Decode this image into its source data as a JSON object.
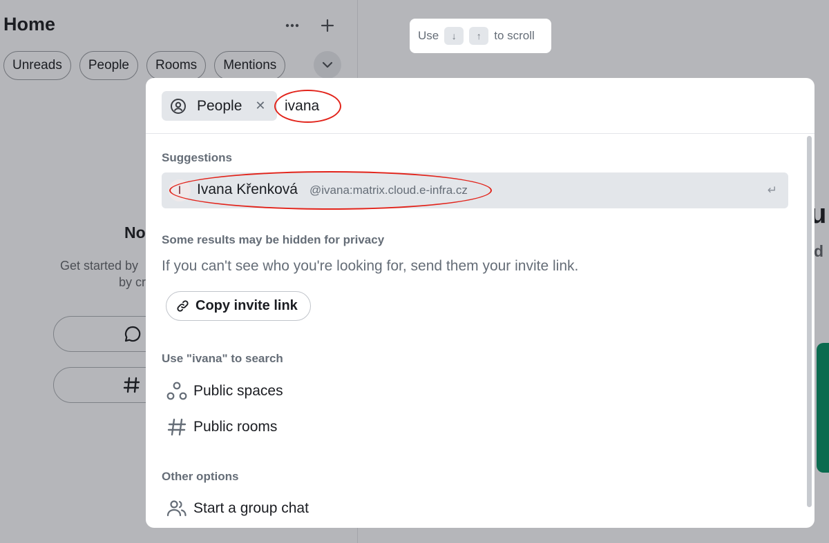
{
  "sidebar": {
    "title": "Home",
    "filters": [
      "Unreads",
      "People",
      "Rooms",
      "Mentions"
    ],
    "empty_title": "No",
    "empty_text_line1": "Get started by",
    "empty_text_line2": "by cr"
  },
  "scroll_hint": {
    "prefix": "Use",
    "down_key": "↓",
    "up_key": "↑",
    "suffix": "to scroll"
  },
  "right_edge": {
    "big": "u",
    "small": "d"
  },
  "dialog": {
    "filter_pill_label": "People",
    "query": "ivana",
    "suggestions_heading": "Suggestions",
    "suggestion": {
      "avatar_letter": "I",
      "name": "Ivana Křenková",
      "user_id": "@ivana:matrix.cloud.e-infra.cz",
      "enter_symbol": "↵"
    },
    "privacy_heading": "Some results may be hidden for privacy",
    "privacy_text": "If you can't see who you're looking for, send them your invite link.",
    "copy_invite_label": "Copy invite link",
    "search_heading": "Use \"ivana\" to search",
    "public_spaces_label": "Public spaces",
    "public_rooms_label": "Public rooms",
    "other_heading": "Other options",
    "group_chat_label": "Start a group chat"
  },
  "colors": {
    "annotation": "#e2231a",
    "accent_green": "#0b6b4f"
  }
}
